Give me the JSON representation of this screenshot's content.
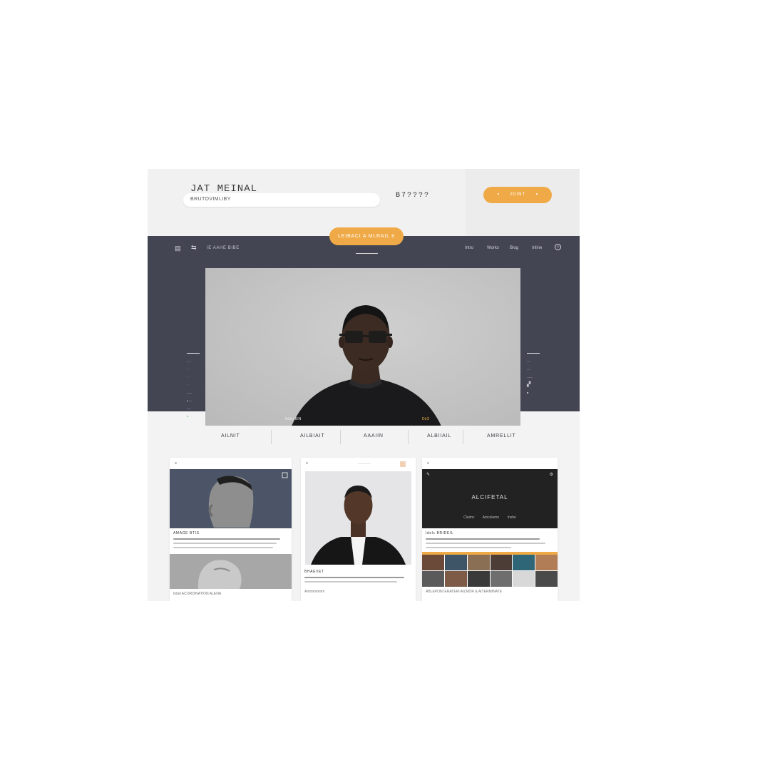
{
  "header": {
    "brand": "JAT  MEINAL",
    "search_text": "BRUTOVIMLIBY",
    "counter": "B7????",
    "join_label": "JOINT"
  },
  "pill": {
    "label": "LEIBACI  A MLRAIL  e"
  },
  "nav": {
    "crumb": "IE AAHE BIBE",
    "links": [
      "Intro",
      "Works",
      "Blog",
      "Inline"
    ]
  },
  "hero": {
    "tag_left": "folder BIN",
    "tag_right": "DLO"
  },
  "tabs": [
    "AILNIT",
    "AILBIAIT",
    "AAAIIN",
    "ALBIIAIL",
    "AMRELLIT"
  ],
  "cards": {
    "c1": {
      "caption": "AMAGE BTIS",
      "footer": "Intall ACORDINATION ALENA"
    },
    "c2": {
      "caption": "BHAEVET",
      "footer": "Ammmmmm"
    },
    "c3": {
      "title": "ALCIFETAL",
      "menu": [
        "Claimc",
        "Amcolumn",
        "Inshe"
      ],
      "caption": "Idelc  BRIDEIL",
      "footer": "ABLEPONI ERATERI AILMOR & AITERMINATE"
    }
  },
  "colors": {
    "accent": "#efaa47",
    "band": "#444553"
  },
  "icons": [
    "menu-icon",
    "share-icon",
    "user-icon",
    "pin-icon",
    "edit-icon"
  ]
}
